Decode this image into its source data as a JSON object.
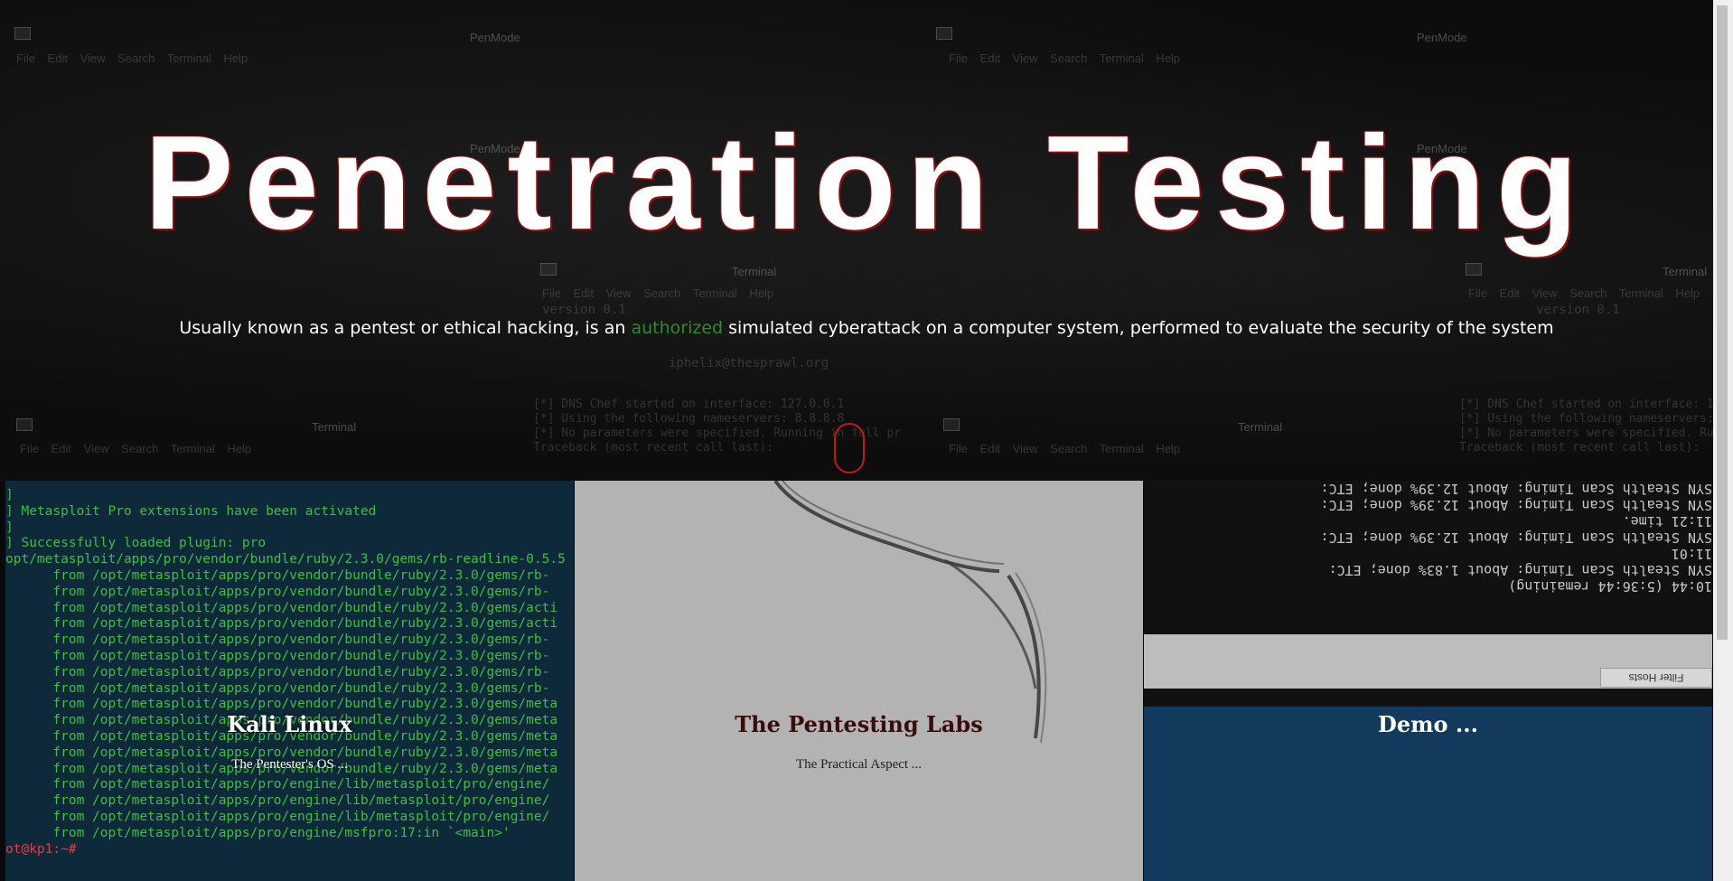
{
  "hero": {
    "title": "Penetration Testing",
    "subtitle_before": "Usually known as a pentest or ethical hacking, is an ",
    "subtitle_highlight": "authorized",
    "subtitle_after": " simulated cyberattack on a computer system, performed to evaluate the security of the system"
  },
  "background_terminals": {
    "titles": [
      "PenMode",
      "PenMode",
      "PenMode",
      "PenMode",
      "Terminal",
      "Terminal",
      "Terminal",
      "Terminal"
    ],
    "menu": "File Edit View Search Terminal Help",
    "dns_lines": [
      "[*] DNS Chef started on interface: 127.0.0.1",
      "[*] Using the following nameservers: 8.8.8.8",
      "[*] No parameters were specified. Running in full pr",
      "Traceback (most recent call last):"
    ],
    "version": "version 0.1",
    "email": "iphelix@thesprawl.org"
  },
  "cards": [
    {
      "title": "Kali Linux",
      "text": "The Pentester's OS ...",
      "terminal_lines": [
        "]",
        "] Metasploit Pro extensions have been activated",
        "]",
        "] Successfully loaded plugin: pro",
        "opt/metasploit/apps/pro/vendor/bundle/ruby/2.3.0/gems/rb-readline-0.5.5",
        "      from /opt/metasploit/apps/pro/vendor/bundle/ruby/2.3.0/gems/rb-",
        "      from /opt/metasploit/apps/pro/vendor/bundle/ruby/2.3.0/gems/rb-",
        "      from /opt/metasploit/apps/pro/vendor/bundle/ruby/2.3.0/gems/acti",
        "      from /opt/metasploit/apps/pro/vendor/bundle/ruby/2.3.0/gems/acti",
        "      from /opt/metasploit/apps/pro/vendor/bundle/ruby/2.3.0/gems/rb-",
        "      from /opt/metasploit/apps/pro/vendor/bundle/ruby/2.3.0/gems/rb-",
        "      from /opt/metasploit/apps/pro/vendor/bundle/ruby/2.3.0/gems/rb-",
        "      from /opt/metasploit/apps/pro/vendor/bundle/ruby/2.3.0/gems/rb-",
        "      from /opt/metasploit/apps/pro/vendor/bundle/ruby/2.3.0/gems/meta",
        "      from /opt/metasploit/apps/pro/vendor/bundle/ruby/2.3.0/gems/meta",
        "      from /opt/metasploit/apps/pro/vendor/bundle/ruby/2.3.0/gems/meta",
        "      from /opt/metasploit/apps/pro/vendor/bundle/ruby/2.3.0/gems/meta",
        "      from /opt/metasploit/apps/pro/vendor/bundle/ruby/2.3.0/gems/meta",
        "      from /opt/metasploit/apps/pro/engine/lib/metasploit/pro/engine/",
        "      from /opt/metasploit/apps/pro/engine/lib/metasploit/pro/engine/",
        "      from /opt/metasploit/apps/pro/engine/lib/metasploit/pro/engine/",
        "      from /opt/metasploit/apps/pro/engine/msfpro:17:in `<main>'",
        "ot@kp1:~# "
      ]
    },
    {
      "title": "The Pentesting Labs",
      "text": "The Practical Aspect ..."
    },
    {
      "title": "Demo ...",
      "text": "",
      "scan_lines": [
        "10:44 (5:36:44 remaining)",
        "SYN Stealth Scan Timing: About 1.83% done; ETC:",
        "11:01",
        "SYN Stealth Scan Timing: About 12.39% done; ETC:",
        "11:21 time.",
        "SYN Stealth Scan Timing: About 12.39% done; ETC:",
        "SYN Stealth Scan Timing: About 12.39% done; ETC:"
      ],
      "filter_label": "Filter Hosts"
    }
  ],
  "colors": {
    "highlight_green": "#2e8b2e",
    "title_outline": "#8b1010",
    "scroll_indicator": "#c0191a"
  }
}
